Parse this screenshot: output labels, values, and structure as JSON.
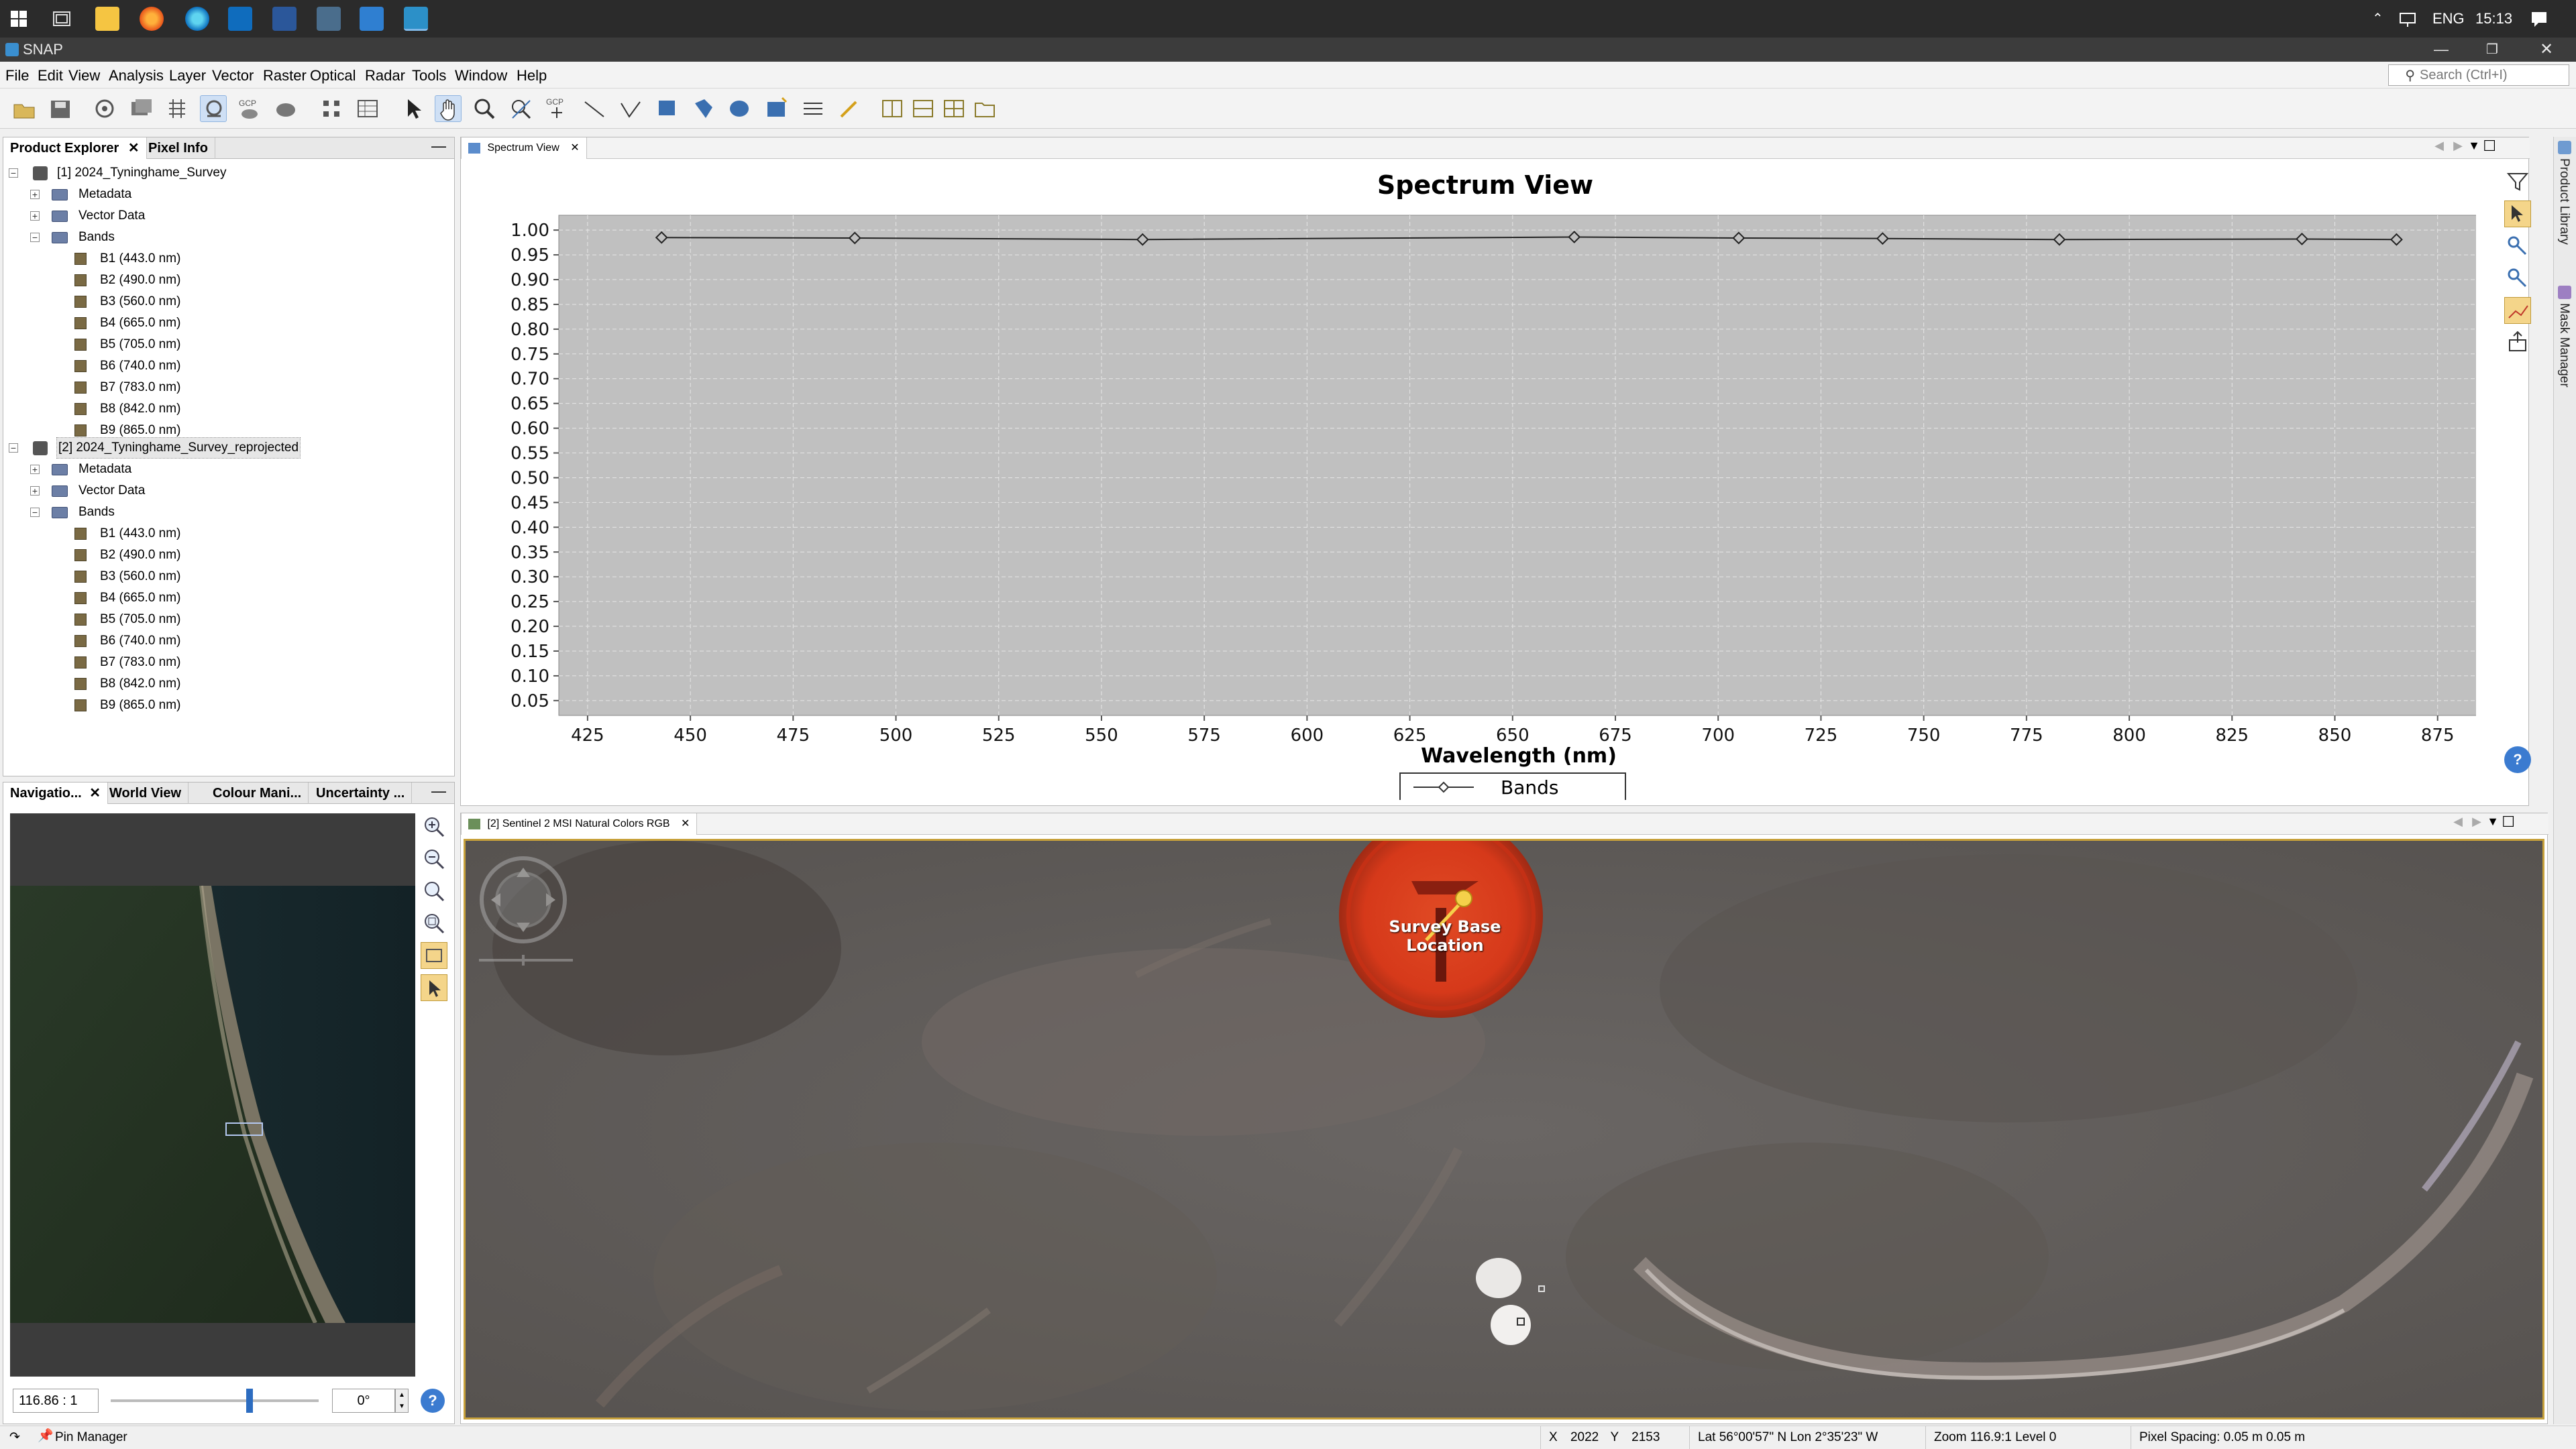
{
  "taskbar": {
    "language": "ENG",
    "time": "15:13",
    "app_icons": [
      "windows-start-icon",
      "task-view-icon",
      "file-explorer-icon",
      "firefox-icon",
      "edge-icon",
      "outlook-icon",
      "word-icon",
      "remote-desktop-icon",
      "photos-icon",
      "snap-icon"
    ]
  },
  "window": {
    "title": "SNAP"
  },
  "menu": {
    "items": [
      "File",
      "Edit",
      "View",
      "Analysis",
      "Layer",
      "Vector",
      "Raster",
      "Optical",
      "Radar",
      "Tools",
      "Window",
      "Help"
    ],
    "search_placeholder": "Search (Ctrl+I)"
  },
  "product_explorer": {
    "tabs": [
      "Product Explorer",
      "Pixel Info"
    ],
    "products": [
      {
        "name": "[1] 2024_Tyninghame_Survey",
        "children": [
          "Metadata",
          "Vector Data",
          "Bands"
        ],
        "bands": [
          "B1 (443.0 nm)",
          "B2 (490.0 nm)",
          "B3 (560.0 nm)",
          "B4 (665.0 nm)",
          "B5 (705.0 nm)",
          "B6 (740.0 nm)",
          "B7 (783.0 nm)",
          "B8 (842.0 nm)",
          "B9 (865.0 nm)"
        ]
      },
      {
        "name": "[2] 2024_Tyninghame_Survey_reprojected",
        "children": [
          "Metadata",
          "Vector Data",
          "Bands"
        ],
        "bands": [
          "B1 (443.0 nm)",
          "B2 (490.0 nm)",
          "B3 (560.0 nm)",
          "B4 (665.0 nm)",
          "B5 (705.0 nm)",
          "B6 (740.0 nm)",
          "B7 (783.0 nm)",
          "B8 (842.0 nm)",
          "B9 (865.0 nm)"
        ]
      }
    ]
  },
  "navigation": {
    "tabs": [
      "Navigatio...",
      "World View",
      "Colour Mani...",
      "Uncertainty ..."
    ],
    "scale": "116.86 : 1",
    "rotation": "0°"
  },
  "spectrum_view": {
    "tab_label": "Spectrum View"
  },
  "chart_data": {
    "type": "line",
    "title": "Spectrum View",
    "xlabel": "Wavelength (nm)",
    "ylabel": "",
    "xlim": [
      418,
      885
    ],
    "ylim": [
      0.02,
      1.03
    ],
    "xticks": [
      425,
      450,
      475,
      500,
      525,
      550,
      575,
      600,
      625,
      650,
      675,
      700,
      725,
      750,
      775,
      800,
      825,
      850,
      875
    ],
    "yticks": [
      0.05,
      0.1,
      0.15,
      0.2,
      0.25,
      0.3,
      0.35,
      0.4,
      0.45,
      0.5,
      0.55,
      0.6,
      0.65,
      0.7,
      0.75,
      0.8,
      0.85,
      0.9,
      0.95,
      1.0
    ],
    "ytick_labels": [
      "0.05",
      "0.10",
      "0.15",
      "0.20",
      "0.25",
      "0.30",
      "0.35",
      "0.40",
      "0.45",
      "0.50",
      "0.55",
      "0.60",
      "0.65",
      "0.70",
      "0.75",
      "0.80",
      "0.85",
      "0.90",
      "0.95",
      "1.00"
    ],
    "grid": true,
    "legend_position": "bottom-center",
    "series": [
      {
        "name": "Bands",
        "x": [
          443,
          490,
          560,
          665,
          705,
          740,
          783,
          842,
          865
        ],
        "y": [
          0.985,
          0.984,
          0.981,
          0.986,
          0.984,
          0.983,
          0.981,
          0.982,
          0.981
        ]
      }
    ]
  },
  "image_view": {
    "tab_label": "[2] Sentinel 2 MSI Natural Colors RGB",
    "pin_label": "Survey Base Location"
  },
  "right_sidebar": {
    "vertical_tabs": [
      "Product Library",
      "Mask Manager"
    ]
  },
  "statusbar": {
    "left_label": "Pin Manager",
    "x_label": "X",
    "x_value": "2022",
    "y_label": "Y",
    "y_value": "2153",
    "latlon": "Lat 56°00'57\" N  Lon 2°35'23\" W",
    "zoom": "Zoom 116.9:1  Level 0",
    "pixel_spacing": "Pixel Spacing: 0.05 m  0.05 m"
  },
  "colors": {
    "chart_plot_bg": "#c0c0c0",
    "pin_red": "#d93a1e",
    "selection_blue": "#cfe0f5"
  }
}
